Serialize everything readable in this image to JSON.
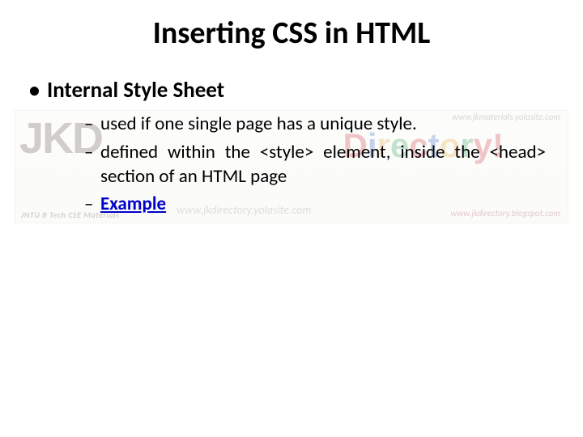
{
  "slide": {
    "title": "Inserting CSS in HTML",
    "bullet1": {
      "text": "Internal Style Sheet",
      "sub": [
        "used if one single page has a unique style.",
        "defined within the <style> element, inside the <head> section of an HTML page",
        "Example"
      ]
    }
  },
  "watermark": {
    "logo_text": "JKD",
    "tagline": "JNTU B Tech CSE Materials",
    "mid_url": "www.jkdirectory.yolasite.com",
    "brand": "Directory!",
    "url_top_right": "www.jkmaterials.yolasite.com",
    "url_bottom_right": "www.jkdirectory.blogspot.com"
  }
}
